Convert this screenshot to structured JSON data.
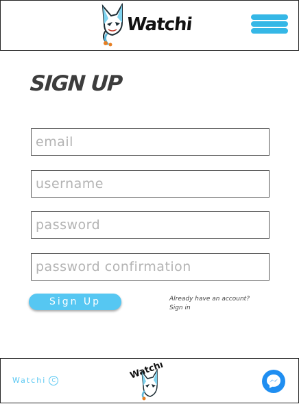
{
  "header": {
    "logo_text": "Watchi",
    "menu_icon": "hamburger-menu-icon"
  },
  "page": {
    "title": "SIGN UP"
  },
  "form": {
    "email_placeholder": "email",
    "username_placeholder": "username",
    "password_placeholder": "password",
    "password_confirmation_placeholder": "password confirmation",
    "signup_label": "Sign Up",
    "already_text": "Already have an account?",
    "signin_label": "Sign in"
  },
  "footer": {
    "brand": "Watchi",
    "copyright_symbol": "C",
    "logo_text": "Watchi",
    "messenger_icon": "messenger-icon"
  },
  "colors": {
    "accent": "#56c7f2",
    "menu": "#35b7e6",
    "messenger": "#1f8ef1"
  }
}
